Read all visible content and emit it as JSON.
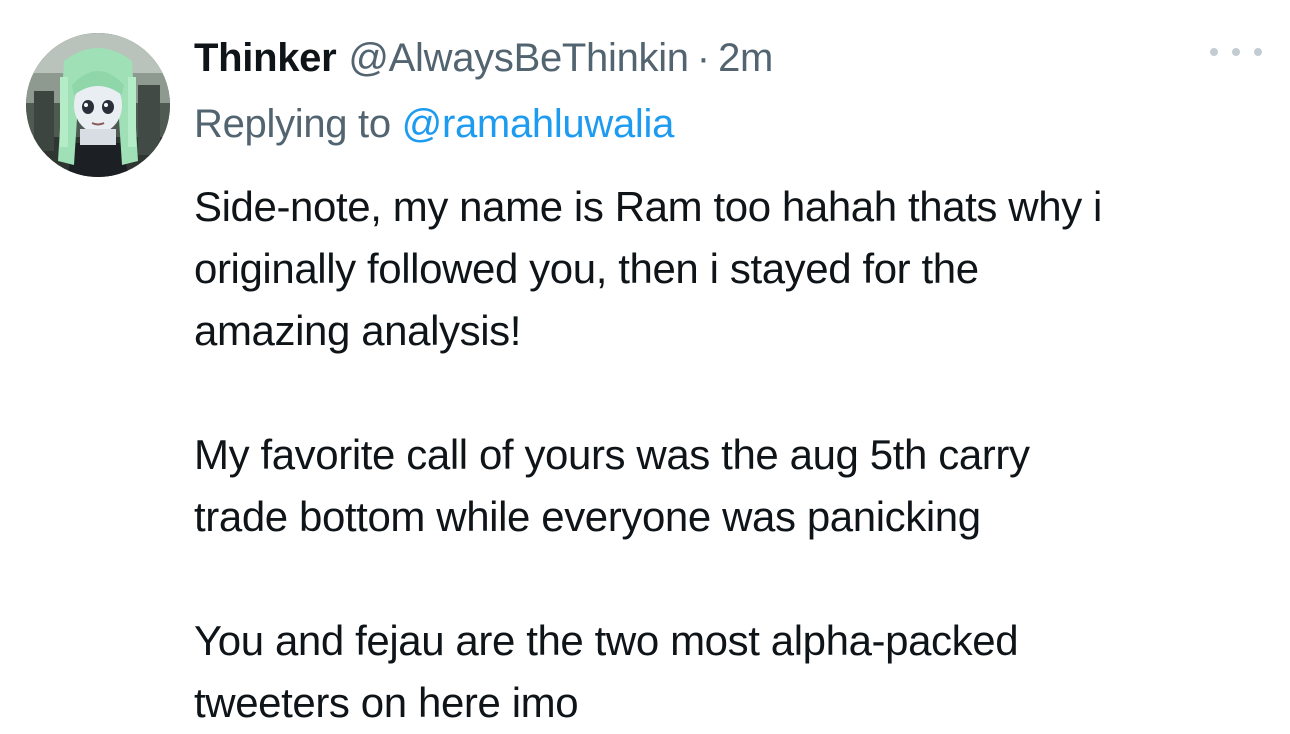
{
  "tweet": {
    "avatar_icon": "anime-avatar-icon",
    "display_name": "Thinker",
    "handle": "@AlwaysBeThinkin",
    "separator": "·",
    "time": "2m",
    "more_icon": "more-dots-icon",
    "reply_prefix": "Replying to",
    "reply_to": "@ramahluwalia",
    "paragraphs": [
      "Side-note, my name is Ram too hahah thats why i\noriginally followed you, then i stayed for the\namazing analysis!",
      "My favorite call of yours was the aug 5th carry\ntrade bottom while everyone was panicking",
      "You and fejau are the two most alpha-packed\ntweeters on here imo"
    ]
  },
  "colors": {
    "text": "#0f1419",
    "secondary": "#536471",
    "link": "#1d9bf0",
    "more_dots": "#c3ccd3"
  }
}
